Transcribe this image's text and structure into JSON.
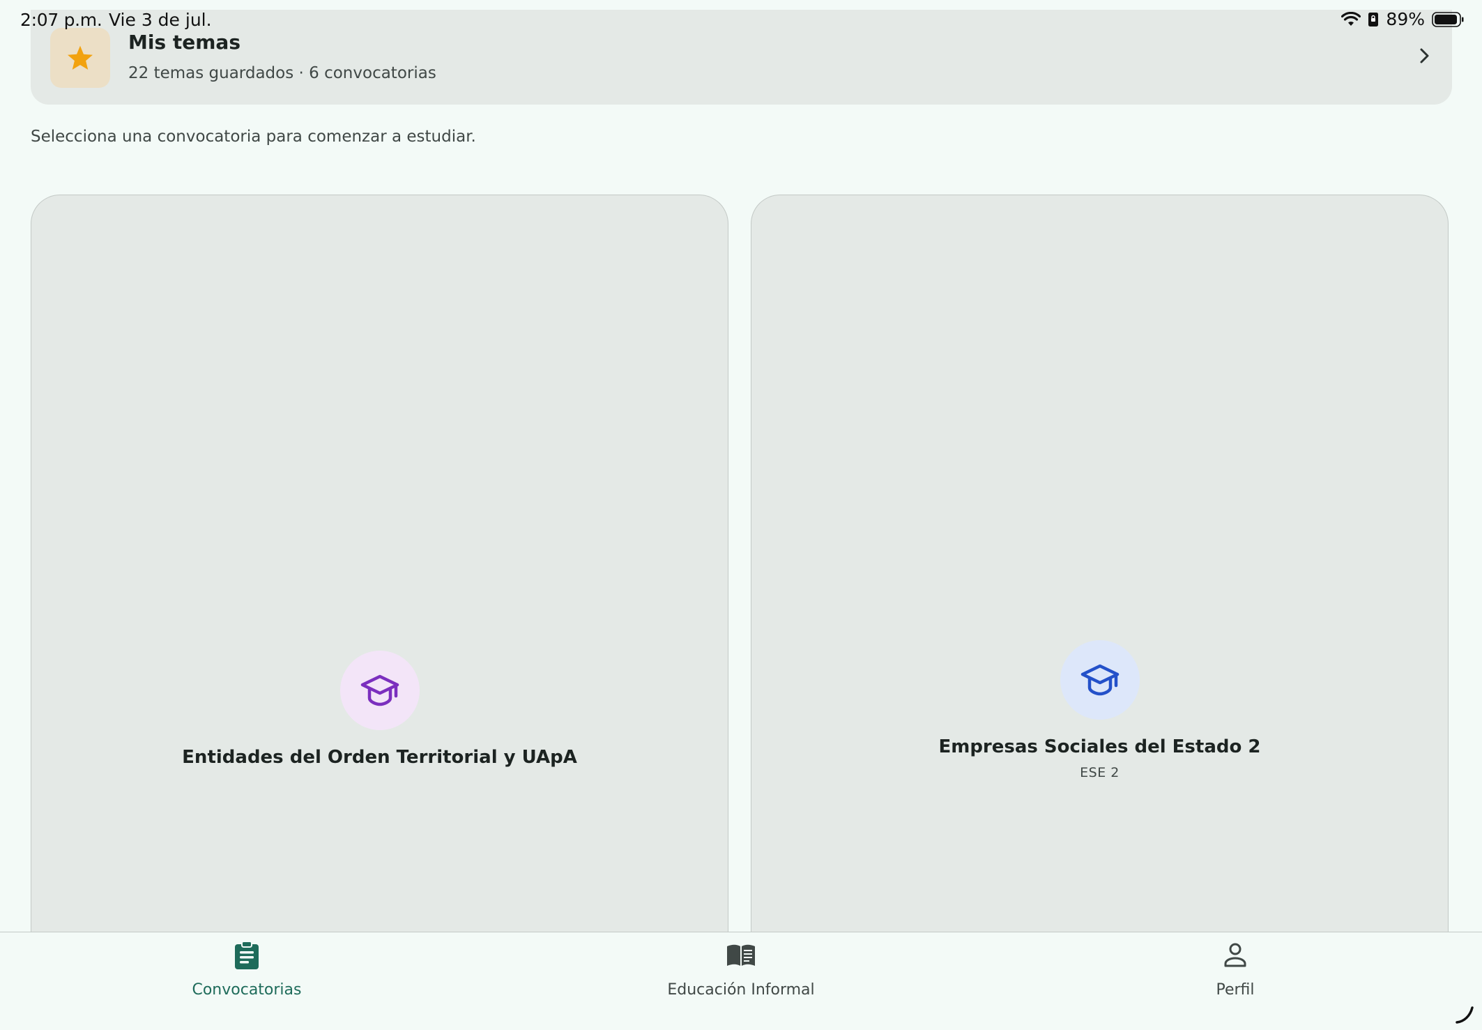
{
  "status": {
    "time": "2:07 p.m.",
    "date": "Vie 3 de jul.",
    "battery": "89%"
  },
  "mis_temas": {
    "title": "Mis temas",
    "subtitle": "22 temas guardados · 6 convocatorias",
    "icon": "star-icon"
  },
  "intro": "Selecciona una convocatoria para comenzar a estudiar.",
  "cards": [
    {
      "title": "Entidades del Orden Territorial y UApA",
      "icon": "graduation-cap-icon",
      "color": "#7b2fbe"
    },
    {
      "title": "Empresas Sociales del Estado 2",
      "code": "ESE 2",
      "icon": "graduation-cap-icon",
      "color": "#2451c9"
    }
  ],
  "nav": {
    "items": [
      {
        "label": "Convocatorias",
        "icon": "clipboard-icon",
        "active": true
      },
      {
        "label": "Educación Informal",
        "icon": "book-icon",
        "active": false
      },
      {
        "label": "Perfil",
        "icon": "person-icon",
        "active": false
      }
    ]
  },
  "colors": {
    "background": "#f3faf7",
    "card": "#e4e9e6",
    "accent": "#1e6b5a",
    "star": "#f2a20f"
  }
}
